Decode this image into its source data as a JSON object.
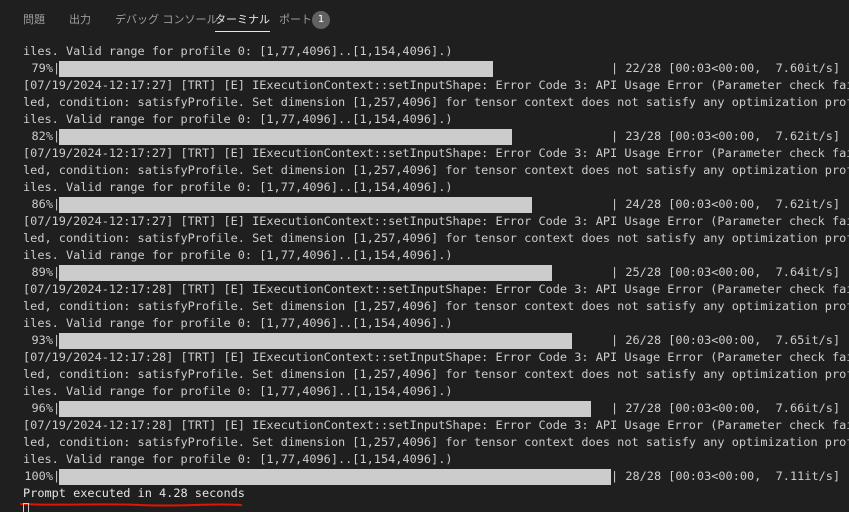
{
  "tabs": [
    {
      "label": "問題",
      "active": false
    },
    {
      "label": "出力",
      "active": false
    },
    {
      "label": "デバッグ コンソール",
      "active": false
    },
    {
      "label": "ターミナル",
      "active": true
    },
    {
      "label": "ポート",
      "active": false
    }
  ],
  "ports_badge": "1",
  "terminal": {
    "first_line": "iles. Valid range for profile 0: [1,77,4096]..[1,154,4096].)",
    "error_line_1": "[07/19/2024-12:17:27] [TRT] [E] IExecutionContext::setInputShape: Error Code 3: API Usage Error (Parameter check fai",
    "error_line_2": "led, condition: satisfyProfile. Set dimension [1,257,4096] for tensor context does not satisfy any optimization prof",
    "error_line_3": "iles. Valid range for profile 0: [1,77,4096]..[1,154,4096].)",
    "progress_rows": [
      {
        "pct": "79%",
        "sep": "|",
        "fraction": 0.786,
        "stats": "| 22/28 [00:03<00:00,  7.60it/s]",
        "error_time": "[07/19/2024-12:17:27]"
      },
      {
        "pct": "82%",
        "sep": "|",
        "fraction": 0.821,
        "stats": "| 23/28 [00:03<00:00,  7.62it/s]",
        "error_time": "[07/19/2024-12:17:27]"
      },
      {
        "pct": "86%",
        "sep": "|",
        "fraction": 0.857,
        "stats": "| 24/28 [00:03<00:00,  7.62it/s]",
        "error_time": "[07/19/2024-12:17:27]"
      },
      {
        "pct": "89%",
        "sep": "|",
        "fraction": 0.893,
        "stats": "| 25/28 [00:03<00:00,  7.64it/s]",
        "error_time": "[07/19/2024-12:17:28]"
      },
      {
        "pct": "93%",
        "sep": "|",
        "fraction": 0.929,
        "stats": "| 26/28 [00:03<00:00,  7.65it/s]",
        "error_time": "[07/19/2024-12:17:28]"
      },
      {
        "pct": "96%",
        "sep": "|",
        "fraction": 0.964,
        "stats": "| 27/28 [00:03<00:00,  7.66it/s]",
        "error_time": "[07/19/2024-12:17:28]"
      },
      {
        "pct": "100%",
        "sep": "|",
        "fraction": 1.0,
        "stats": "| 28/28 [00:03<00:00,  7.11it/s]",
        "error_time": null
      }
    ],
    "error_suffix_1": " [TRT] [E] IExecutionContext::setInputShape: Error Code 3: API Usage Error (Parameter check fai",
    "final_line": "Prompt executed in 4.28 seconds"
  },
  "colors": {
    "background": "#1f1f1f",
    "text": "#cccccc",
    "bar": "#cccccc",
    "annotation_underline": "#e51400"
  }
}
